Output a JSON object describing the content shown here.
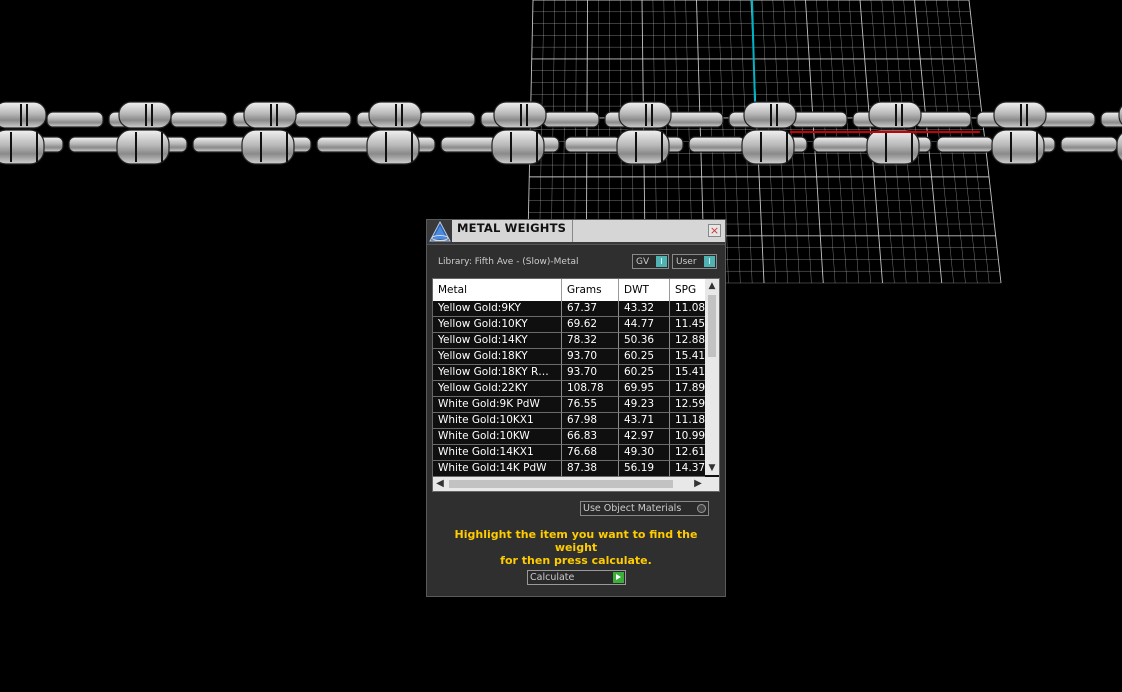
{
  "panel": {
    "title": "METAL WEIGHTS",
    "close_glyph": "×",
    "library": "Library: Fifth Ave - (Slow)-Metal",
    "toggle_gv": "GV",
    "toggle_user": "User",
    "toggle_glyph": "I",
    "use_object_materials": "Use Object Materials",
    "instruction_line1": "Highlight the item you want to find the weight",
    "instruction_line2": "for then press calculate.",
    "calculate": "Calculate"
  },
  "table": {
    "headers": [
      "Metal",
      "Grams",
      "DWT",
      "SPG"
    ],
    "rows": [
      [
        "Yellow Gold:9KY",
        "67.37",
        "43.32",
        "11.08"
      ],
      [
        "Yellow Gold:10KY",
        "69.62",
        "44.77",
        "11.45"
      ],
      [
        "Yellow Gold:14KY",
        "78.32",
        "50.36",
        "12.88"
      ],
      [
        "Yellow Gold:18KY",
        "93.70",
        "60.25",
        "15.41"
      ],
      [
        "Yellow Gold:18KY R…",
        "93.70",
        "60.25",
        "15.41"
      ],
      [
        "Yellow Gold:22KY",
        "108.78",
        "69.95",
        "17.89"
      ],
      [
        "White Gold:9K PdW",
        "76.55",
        "49.23",
        "12.59"
      ],
      [
        "White Gold:10KX1",
        "67.98",
        "43.71",
        "11.18"
      ],
      [
        "White Gold:10KW",
        "66.83",
        "42.97",
        "10.99"
      ],
      [
        "White Gold:14KX1",
        "76.68",
        "49.30",
        "12.61"
      ],
      [
        "White Gold:14K PdW",
        "87.38",
        "56.19",
        "14.37"
      ]
    ]
  },
  "icons": {
    "logo": "triangle-logo-icon",
    "close": "close-icon",
    "scroll_up": "▲",
    "scroll_down": "▼",
    "scroll_left": "◀",
    "scroll_right": "▶"
  },
  "colors": {
    "instruction": "#ffcc00",
    "toggle_on": "#4fb3b3",
    "calculate_go": "#3cae3c",
    "grid": "#d8d8d8",
    "axis_y": "#00b4c8",
    "axis_x": "#cc0000"
  }
}
